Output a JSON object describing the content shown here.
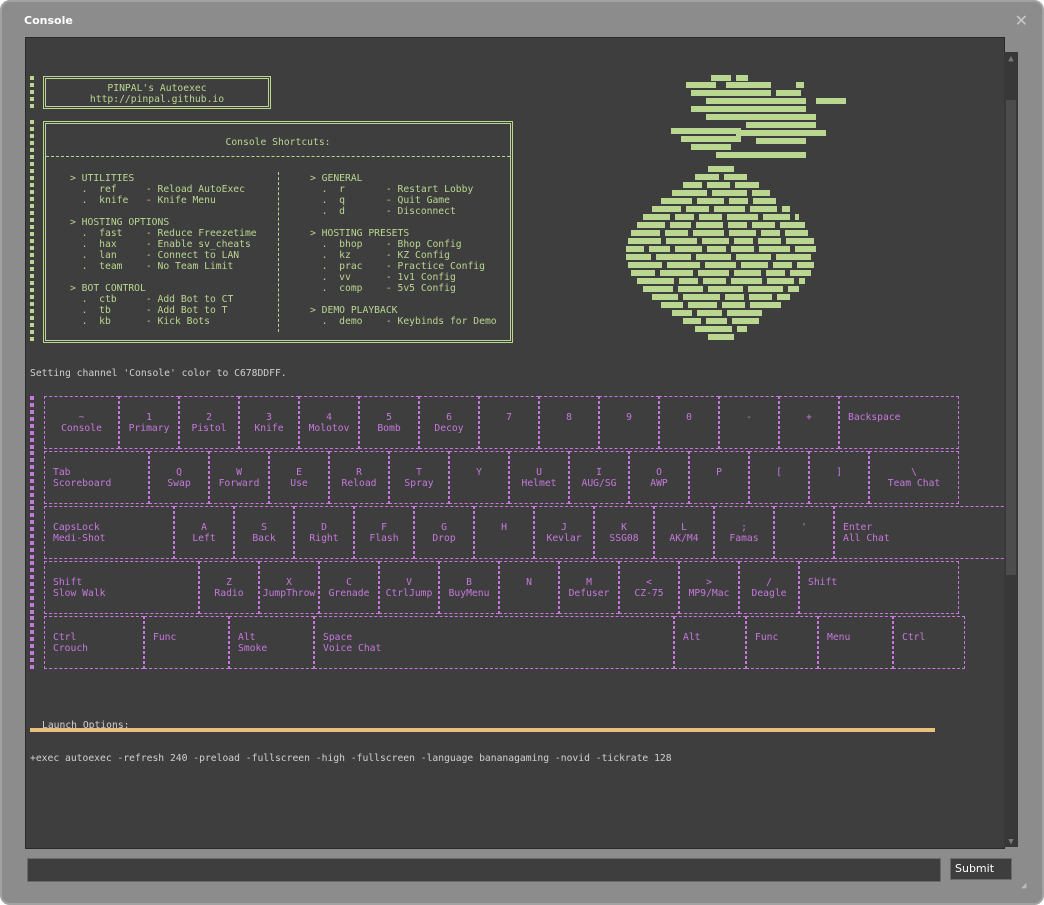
{
  "window": {
    "title": "Console",
    "close_icon": "close-icon"
  },
  "header_box": [
    "PINPAL's Autoexec",
    "http://pinpal.github.io"
  ],
  "shortcuts": {
    "title": "Console Shortcuts:",
    "left": [
      "> UTILITIES",
      "  .  ref     - Reload AutoExec",
      "  .  knife   - Knife Menu",
      "",
      "> HOSTING OPTIONS",
      "  .  fast    - Reduce Freezetime",
      "  .  hax     - Enable sv_cheats",
      "  .  lan     - Connect to LAN",
      "  .  team    - No Team Limit",
      "",
      "> BOT CONTROL",
      "  .  ctb     - Add Bot to CT",
      "  .  tb      - Add Bot to T",
      "  .  kb      - Kick Bots"
    ],
    "right": [
      "> GENERAL",
      "  .  r       - Restart Lobby",
      "  .  q       - Quit Game",
      "  .  d       - Disconnect",
      "",
      "> HOSTING PRESETS",
      "  .  bhop    - Bhop Config",
      "  .  kz      - KZ Config",
      "  .  prac    - Practice Config",
      "  .  vv      - 1v1 Config",
      "  .  comp    - 5v5 Config",
      "",
      "> DEMO PLAYBACK",
      "  .  demo    - Keybinds for Demo"
    ]
  },
  "message": "Setting channel 'Console' color to C678DDFF.",
  "keyboard": [
    [
      [
        "~",
        "Console"
      ],
      [
        "1",
        "Primary"
      ],
      [
        "2",
        "Pistol"
      ],
      [
        "3",
        "Knife"
      ],
      [
        "4",
        "Molotov"
      ],
      [
        "5",
        "Bomb"
      ],
      [
        "6",
        "Decoy"
      ],
      [
        "7",
        ""
      ],
      [
        "8",
        ""
      ],
      [
        "9",
        ""
      ],
      [
        "0",
        ""
      ],
      [
        "-",
        ""
      ],
      [
        "+",
        ""
      ],
      [
        "Backspace",
        ""
      ]
    ],
    [
      [
        "Tab",
        "Scoreboard"
      ],
      [
        "Q",
        "Swap"
      ],
      [
        "W",
        "Forward"
      ],
      [
        "E",
        "Use"
      ],
      [
        "R",
        "Reload"
      ],
      [
        "T",
        "Spray"
      ],
      [
        "Y",
        ""
      ],
      [
        "U",
        "Helmet"
      ],
      [
        "I",
        "AUG/SG"
      ],
      [
        "O",
        "AWP"
      ],
      [
        "P",
        ""
      ],
      [
        "[",
        ""
      ],
      [
        "]",
        ""
      ],
      [
        "\\",
        "Team Chat"
      ]
    ],
    [
      [
        "CapsLock",
        "Medi-Shot"
      ],
      [
        "A",
        "Left"
      ],
      [
        "S",
        "Back"
      ],
      [
        "D",
        "Right"
      ],
      [
        "F",
        "Flash"
      ],
      [
        "G",
        "Drop"
      ],
      [
        "H",
        ""
      ],
      [
        "J",
        "Kevlar"
      ],
      [
        "K",
        "SSG08"
      ],
      [
        "L",
        "AK/M4"
      ],
      [
        ";",
        "Famas"
      ],
      [
        "'",
        ""
      ],
      [
        "Enter",
        "All Chat"
      ]
    ],
    [
      [
        "Shift",
        "Slow Walk"
      ],
      [
        "Z",
        "Radio"
      ],
      [
        "X",
        "JumpThrow"
      ],
      [
        "C",
        "Grenade"
      ],
      [
        "V",
        "CtrlJump"
      ],
      [
        "B",
        "BuyMenu"
      ],
      [
        "N",
        ""
      ],
      [
        "M",
        "Defuser"
      ],
      [
        "<",
        "CZ-75"
      ],
      [
        ">",
        "MP9/Mac"
      ],
      [
        "/",
        "Deagle"
      ],
      [
        "Shift",
        ""
      ]
    ],
    [
      [
        "Ctrl",
        "Crouch"
      ],
      [
        "Func",
        ""
      ],
      [
        "Alt",
        "Smoke"
      ],
      [
        "Space",
        "Voice Chat"
      ],
      [
        "Alt",
        ""
      ],
      [
        "Func",
        ""
      ],
      [
        "Menu",
        ""
      ],
      [
        "Ctrl",
        ""
      ]
    ]
  ],
  "launch": {
    "label": "Launch Options:",
    "value": "+exec autoexec -refresh 240 -preload -fullscreen -high -fullscreen -language bananagaming -novid -tickrate 128"
  },
  "input": {
    "value": "",
    "placeholder": ""
  },
  "submit_label": "Submit",
  "colors": {
    "accent": "#c678dd",
    "ascii": "#b9d790",
    "bar": "#e8c07d",
    "bg": "#3e3e3e"
  }
}
